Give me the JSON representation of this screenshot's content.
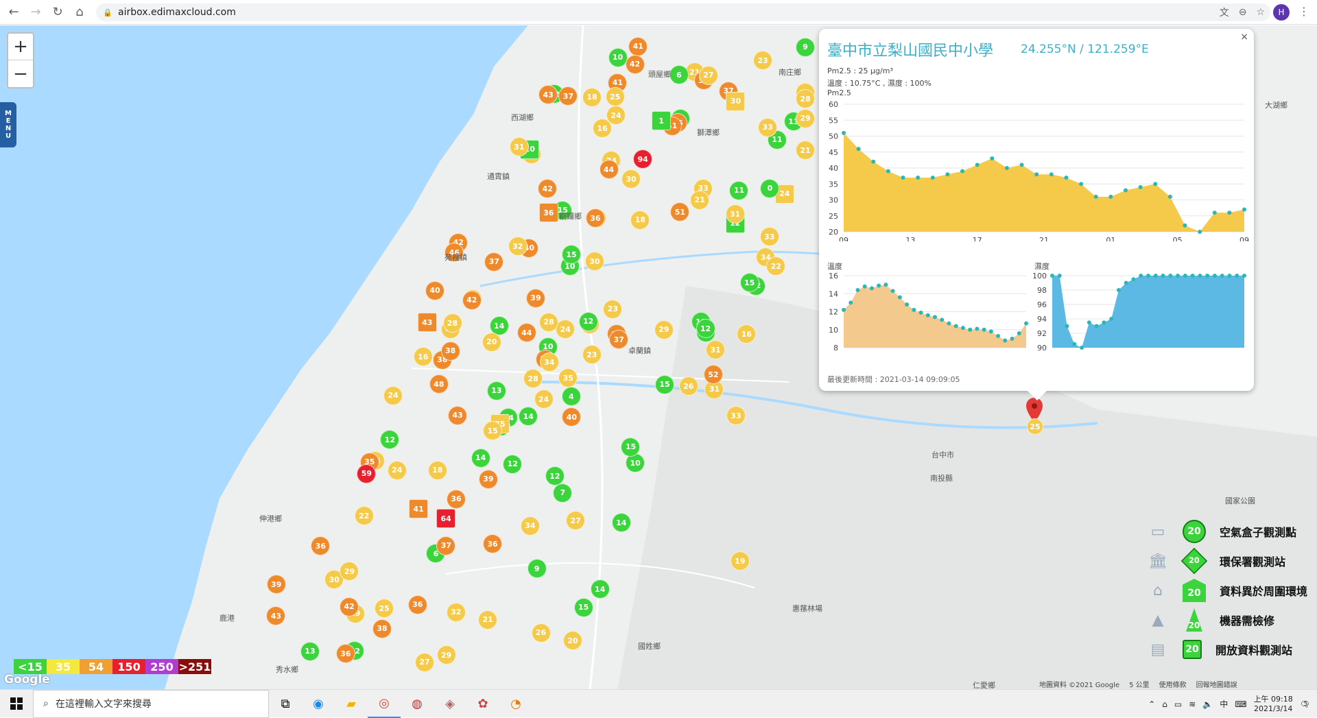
{
  "browser": {
    "url": "airbox.edimaxcloud.com",
    "profile_initial": "H"
  },
  "map": {
    "zoom_in": "+",
    "zoom_out": "−",
    "menu_label": "MENU",
    "google_logo": "Google",
    "footer": [
      "地圖資料 ©2021 Google",
      "5 公里",
      "使用條款",
      "回報地圖錯誤"
    ],
    "place_labels": [
      "南庄鄉",
      "頭屋鄉",
      "西湖鄉",
      "獅潭鄉",
      "大湖鄉",
      "通霄鎮",
      "銅鑼鄉",
      "苑裡鎮",
      "卓蘭鎮",
      "伸港鄉",
      "鹿港",
      "秀水鄉",
      "國姓鄉",
      "台中市",
      "南投縣",
      "惠蓀林場",
      "仁愛鄉",
      "國家公園"
    ],
    "markers": [
      {
        "v": "23",
        "c": "y"
      },
      {
        "v": "24",
        "c": "y"
      },
      {
        "v": "21",
        "c": "y"
      },
      {
        "v": "17",
        "c": "y"
      },
      {
        "v": "14",
        "c": "g"
      },
      {
        "v": "12",
        "c": "g"
      },
      {
        "v": "26",
        "c": "y"
      },
      {
        "v": "38",
        "c": "o"
      },
      {
        "v": "24",
        "c": "y"
      },
      {
        "v": "24",
        "c": "y"
      },
      {
        "v": "21",
        "c": "y"
      },
      {
        "v": "20",
        "c": "y"
      },
      {
        "v": "15",
        "c": "g"
      },
      {
        "v": "13",
        "c": "g"
      },
      {
        "v": "23",
        "c": "y"
      },
      {
        "v": "18",
        "c": "y"
      },
      {
        "v": "21",
        "c": "y"
      },
      {
        "v": "14",
        "c": "g"
      },
      {
        "v": "13",
        "c": "g"
      },
      {
        "v": "11",
        "c": "g"
      },
      {
        "v": "10",
        "c": "g"
      },
      {
        "v": "22",
        "c": "y"
      },
      {
        "v": "24",
        "c": "y"
      },
      {
        "v": "20",
        "c": "y"
      },
      {
        "v": "14",
        "c": "g"
      },
      {
        "v": "34",
        "c": "y"
      },
      {
        "v": "16",
        "c": "y"
      },
      {
        "v": "23",
        "c": "y"
      },
      {
        "v": "21",
        "c": "y"
      },
      {
        "v": "12",
        "c": "g"
      },
      {
        "v": "12",
        "c": "g"
      },
      {
        "v": "12",
        "c": "g"
      },
      {
        "v": "13",
        "c": "g"
      },
      {
        "v": "24",
        "c": "y"
      },
      {
        "v": "15",
        "c": "g"
      },
      {
        "v": "22",
        "c": "y"
      },
      {
        "v": "31",
        "c": "y"
      },
      {
        "v": "14",
        "c": "g"
      },
      {
        "v": "26",
        "c": "y"
      },
      {
        "v": "64",
        "c": "r"
      },
      {
        "v": "24",
        "c": "y"
      },
      {
        "v": "40",
        "c": "o"
      },
      {
        "v": "30",
        "c": "y"
      },
      {
        "v": "39",
        "c": "o"
      },
      {
        "v": "51",
        "c": "o"
      },
      {
        "v": "41",
        "c": "o"
      },
      {
        "v": "43",
        "c": "o"
      },
      {
        "v": "28",
        "c": "y"
      },
      {
        "v": "13",
        "c": "g"
      },
      {
        "v": "14",
        "c": "g"
      },
      {
        "v": "13",
        "c": "g"
      },
      {
        "v": "19",
        "c": "y"
      },
      {
        "v": "10",
        "c": "g"
      },
      {
        "v": "7",
        "c": "g"
      },
      {
        "v": "10",
        "c": "g"
      },
      {
        "v": "0",
        "c": "g"
      },
      {
        "v": "10",
        "c": "g"
      },
      {
        "v": "12",
        "c": "g"
      },
      {
        "v": "15",
        "c": "g"
      },
      {
        "v": "30",
        "c": "y"
      },
      {
        "v": "16",
        "c": "y"
      },
      {
        "v": "18",
        "c": "y"
      },
      {
        "v": "41",
        "c": "o"
      },
      {
        "v": "42",
        "c": "o"
      },
      {
        "v": "36",
        "c": "o"
      },
      {
        "v": "31",
        "c": "y"
      },
      {
        "v": "12",
        "c": "g"
      },
      {
        "v": "32",
        "c": "y"
      },
      {
        "v": "10",
        "c": "g"
      },
      {
        "v": "9",
        "c": "g"
      },
      {
        "v": "29",
        "c": "y"
      },
      {
        "v": "34",
        "c": "y"
      },
      {
        "v": "36",
        "c": "o"
      },
      {
        "v": "36",
        "c": "o"
      },
      {
        "v": "37",
        "c": "o"
      },
      {
        "v": "43",
        "c": "o"
      },
      {
        "v": "24",
        "c": "y"
      },
      {
        "v": "23",
        "c": "y"
      },
      {
        "v": "28",
        "c": "y"
      },
      {
        "v": "26",
        "c": "y"
      },
      {
        "v": "28",
        "c": "y"
      },
      {
        "v": "29",
        "c": "y"
      },
      {
        "v": "12",
        "c": "g"
      },
      {
        "v": "21",
        "c": "y"
      },
      {
        "v": "39",
        "c": "o"
      },
      {
        "v": "42",
        "c": "o"
      },
      {
        "v": "38",
        "c": "o"
      },
      {
        "v": "36",
        "c": "o"
      },
      {
        "v": "31",
        "c": "y"
      },
      {
        "v": "15",
        "c": "g"
      },
      {
        "v": "43",
        "c": "o"
      },
      {
        "v": "27",
        "c": "y"
      },
      {
        "v": "14",
        "c": "g"
      },
      {
        "v": "27",
        "c": "y"
      },
      {
        "v": "34",
        "c": "y"
      },
      {
        "v": "36",
        "c": "o"
      },
      {
        "v": "6",
        "c": "g"
      },
      {
        "v": "37",
        "c": "o"
      },
      {
        "v": "35",
        "c": "o"
      },
      {
        "v": "59",
        "c": "r"
      },
      {
        "v": "44",
        "c": "o"
      },
      {
        "v": "42",
        "c": "o"
      },
      {
        "v": "36",
        "c": "o"
      },
      {
        "v": "42",
        "c": "o"
      },
      {
        "v": "94",
        "c": "r"
      },
      {
        "v": "11",
        "c": "g"
      },
      {
        "v": "33",
        "c": "y"
      },
      {
        "v": "35",
        "c": "y"
      },
      {
        "v": "29",
        "c": "y"
      },
      {
        "v": "30",
        "c": "y"
      },
      {
        "v": "32",
        "c": "y"
      },
      {
        "v": "37",
        "c": "o"
      },
      {
        "v": "38",
        "c": "o"
      },
      {
        "v": "39",
        "c": "o"
      },
      {
        "v": "46",
        "c": "o"
      },
      {
        "v": "37",
        "c": "o"
      },
      {
        "v": "44",
        "c": "o"
      },
      {
        "v": "43",
        "c": "o"
      },
      {
        "v": "42",
        "c": "o"
      },
      {
        "v": "40",
        "c": "o"
      },
      {
        "v": "45",
        "c": "o"
      },
      {
        "v": "39",
        "c": "o"
      },
      {
        "v": "48",
        "c": "o"
      },
      {
        "v": "37",
        "c": "o"
      },
      {
        "v": "41",
        "c": "o"
      },
      {
        "v": "33",
        "c": "y"
      },
      {
        "v": "15",
        "c": "g"
      },
      {
        "v": "12",
        "c": "g"
      },
      {
        "v": "6",
        "c": "g"
      },
      {
        "v": "25",
        "c": "y"
      },
      {
        "v": "33",
        "c": "y"
      },
      {
        "v": "40",
        "c": "o"
      },
      {
        "v": "25",
        "c": "y"
      },
      {
        "v": "32",
        "c": "y"
      },
      {
        "v": "38",
        "c": "o"
      },
      {
        "v": "37",
        "c": "o"
      },
      {
        "v": "36",
        "c": "o"
      },
      {
        "v": "41",
        "c": "o"
      },
      {
        "v": "29",
        "c": "y"
      },
      {
        "v": "15",
        "c": "g"
      },
      {
        "v": "4",
        "c": "g"
      },
      {
        "v": "1",
        "c": "g"
      },
      {
        "v": "9",
        "c": "g"
      },
      {
        "v": "35",
        "c": "y"
      },
      {
        "v": "15",
        "c": "y"
      },
      {
        "v": "18",
        "c": "y"
      },
      {
        "v": "15",
        "c": "g"
      },
      {
        "v": "14",
        "c": "g"
      },
      {
        "v": "12",
        "c": "g"
      },
      {
        "v": "28",
        "c": "y"
      },
      {
        "v": "25",
        "c": "y"
      },
      {
        "v": "21",
        "c": "y"
      },
      {
        "v": "22",
        "c": "y"
      },
      {
        "v": "19",
        "c": "y"
      },
      {
        "v": "27",
        "c": "y"
      },
      {
        "v": "31",
        "c": "y"
      },
      {
        "v": "52",
        "c": "o"
      },
      {
        "v": "33",
        "c": "y"
      },
      {
        "v": "30",
        "c": "y"
      },
      {
        "v": "16",
        "c": "y"
      }
    ]
  },
  "popup": {
    "title": "臺中市立梨山國民中小學",
    "coords": "24.255°N / 121.259°E",
    "pm_line": "Pm2.5 : 25 μg/m³",
    "temp_line": "溫度 : 10.75°C , 濕度 : 100%",
    "pm_chart_label": "Pm2.5",
    "temp_chart_label": "溫度",
    "hum_chart_label": "濕度",
    "updated": "最後更新時間 : 2021-03-14 09:09:05",
    "close": "×"
  },
  "chart_data": [
    {
      "type": "area",
      "title": "Pm2.5",
      "x": [
        "09",
        "10",
        "11",
        "12",
        "13",
        "14",
        "15",
        "16",
        "17",
        "18",
        "19",
        "20",
        "21",
        "22",
        "23",
        "00",
        "01",
        "02",
        "03",
        "04",
        "05",
        "06",
        "07",
        "08",
        "09"
      ],
      "tick_labels": [
        "09",
        "13",
        "17",
        "21",
        "01",
        "05",
        "09"
      ],
      "series": [
        {
          "name": "Pm2.5",
          "values": [
            51,
            46,
            42,
            39,
            37,
            37,
            37,
            38,
            39,
            41,
            43,
            40,
            41,
            38,
            38,
            37,
            35,
            31,
            31,
            33,
            34,
            35,
            31,
            22,
            20,
            26,
            26,
            27
          ]
        }
      ],
      "ylim": [
        20,
        60
      ],
      "yticks": [
        20,
        25,
        30,
        35,
        40,
        45,
        50,
        55,
        60
      ],
      "colors": {
        "fill": "#f5c94a",
        "peak": "#ef8a2c",
        "point": "#2bb7b7"
      }
    },
    {
      "type": "area",
      "title": "溫度",
      "series": [
        {
          "name": "溫度",
          "values": [
            12.2,
            13.0,
            14.4,
            14.8,
            14.6,
            14.9,
            15.0,
            14.3,
            13.6,
            12.8,
            12.2,
            11.9,
            11.6,
            11.4,
            11.1,
            10.7,
            10.4,
            10.2,
            10.0,
            10.1,
            10.0,
            9.8,
            9.3,
            8.8,
            9.0,
            9.6,
            10.7
          ]
        }
      ],
      "ylim": [
        8,
        16
      ],
      "yticks": [
        8,
        10,
        12,
        14,
        16
      ],
      "colors": {
        "fill": "#f3c98d",
        "point": "#2bb7b7"
      }
    },
    {
      "type": "area",
      "title": "濕度",
      "series": [
        {
          "name": "濕度",
          "values": [
            100,
            100,
            93,
            90.5,
            90,
            93.5,
            93,
            93.5,
            94,
            98,
            99,
            99.5,
            100,
            100,
            100,
            100,
            100,
            100,
            100,
            100,
            100,
            100,
            100,
            100,
            100,
            100,
            100
          ]
        }
      ],
      "ylim": [
        90,
        100
      ],
      "yticks": [
        90,
        92,
        94,
        96,
        98,
        100
      ],
      "colors": {
        "fill": "#5bb9e3",
        "point": "#2bb7b7"
      }
    }
  ],
  "legend": [
    {
      "label": "空氣盒子觀測點",
      "value": "20"
    },
    {
      "label": "環保署觀測站",
      "value": "20"
    },
    {
      "label": "資料異於周圍環境",
      "value": "20"
    },
    {
      "label": "機器需檢修",
      "value": "20"
    },
    {
      "label": "開放資料觀測站",
      "value": "20"
    }
  ],
  "scale": [
    {
      "label": "<15",
      "color": "#3cd43c"
    },
    {
      "label": "35",
      "color": "#f5e83c"
    },
    {
      "label": "54",
      "color": "#f0a030"
    },
    {
      "label": "150",
      "color": "#e7202d"
    },
    {
      "label": "250",
      "color": "#b23cd0"
    },
    {
      "label": ">251",
      "color": "#8a0d0d"
    }
  ],
  "taskbar": {
    "search_placeholder": "在這裡輸入文字來搜尋",
    "ime": "中",
    "time": "上午 09:18",
    "date": "2021/3/14",
    "notifications": "5"
  }
}
